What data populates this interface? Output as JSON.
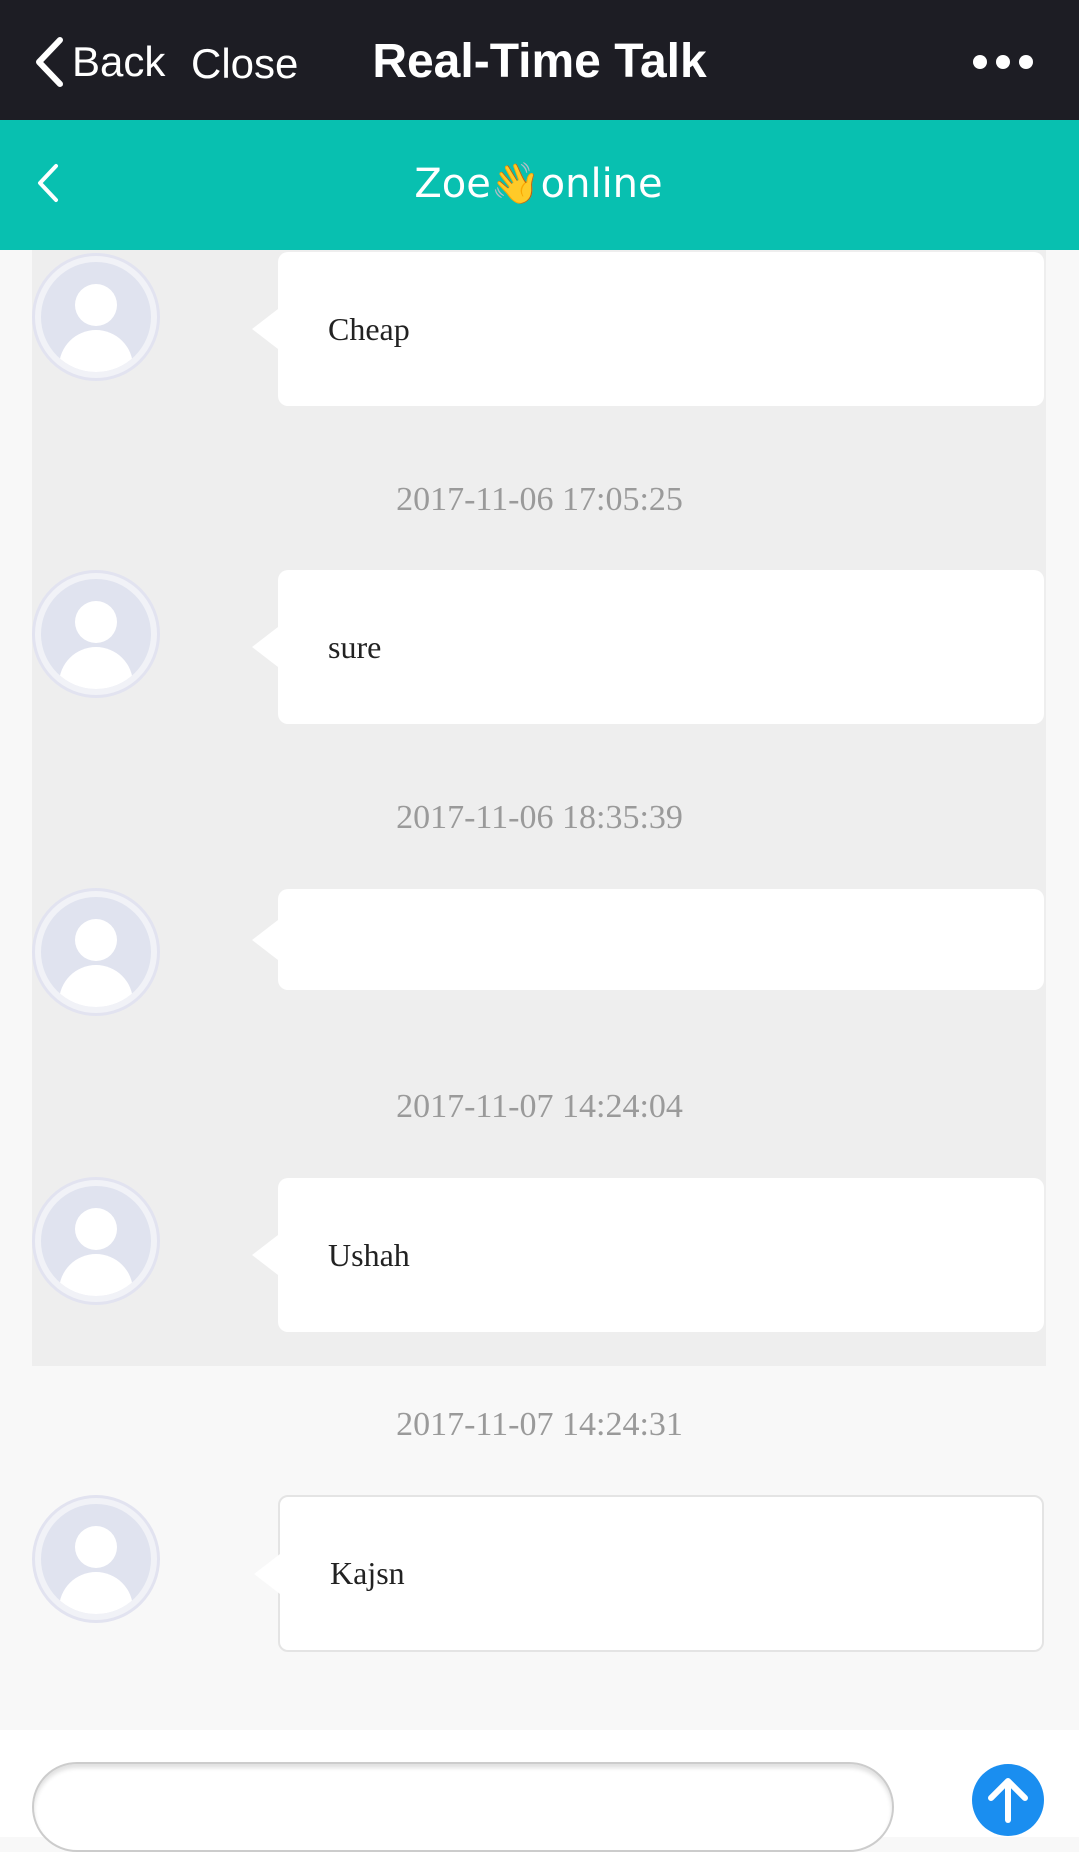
{
  "header": {
    "back_label": "Back",
    "close_label": "Close",
    "title": "Real-Time Talk",
    "more_icon": "more-dots-icon",
    "background": "#1d1d24"
  },
  "chat_header": {
    "back_icon": "chevron-left-icon",
    "title": "Zoe👋online",
    "background": "#08c0b0"
  },
  "messages": [
    {
      "text": "Cheap"
    },
    {
      "timestamp": "2017-11-06 17:05:25",
      "text": "sure"
    },
    {
      "timestamp": "2017-11-06 18:35:39",
      "text": ""
    },
    {
      "timestamp": "2017-11-07 14:24:04",
      "text": "Ushah"
    },
    {
      "timestamp": "2017-11-07 14:24:31",
      "text": "Kajsn"
    }
  ],
  "composer": {
    "placeholder": "",
    "send_icon": "arrow-up-icon",
    "send_color": "#1a8ef0"
  }
}
